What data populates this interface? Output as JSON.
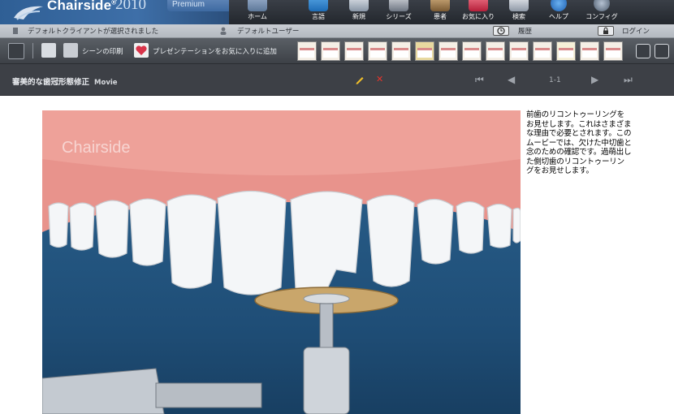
{
  "app": {
    "brand": "Chairside",
    "brand_mark": "®",
    "year": "2010",
    "edition": "Premium",
    "watermark": "Chairside"
  },
  "nav": [
    {
      "label": "ホーム",
      "icon": "home-icon"
    },
    {
      "label": "言語",
      "icon": "language-icon"
    },
    {
      "label": "新規",
      "icon": "new-icon"
    },
    {
      "label": "シリーズ",
      "icon": "series-icon"
    },
    {
      "label": "患者",
      "icon": "patient-icon"
    },
    {
      "label": "お気に入り",
      "icon": "favorites-icon"
    },
    {
      "label": "検索",
      "icon": "search-icon"
    },
    {
      "label": "ヘルプ",
      "icon": "help-icon"
    },
    {
      "label": "コンフィグ",
      "icon": "config-icon"
    }
  ],
  "info": {
    "client_text": "デフォルトクライアントが選択されました",
    "user_text": "デフォルトユーザー",
    "history_label": "履歴",
    "login_label": "ログイン"
  },
  "toolbar": {
    "print_label": "シーンの印刷",
    "favorite_label": "プレゼンテーションをお気に入りに追加",
    "thumbnail_count_note": ""
  },
  "viewer": {
    "title": "審美的な歯冠形態修正",
    "type_tag": "Movie",
    "page_indicator": "1-1"
  },
  "description": "前歯のリコントゥーリングをお見せします。これはさまざまな理由で必要とされます。このムービーでは、欠けた中切歯と念のための確認です。過萌出した側切歯のリコントゥーリングをお見せします。",
  "colors": {
    "accent_blue": "#3e6fa8",
    "delete_red": "#e8342b",
    "edit_yellow": "#f2c029",
    "favorite_red": "#d9344a"
  }
}
